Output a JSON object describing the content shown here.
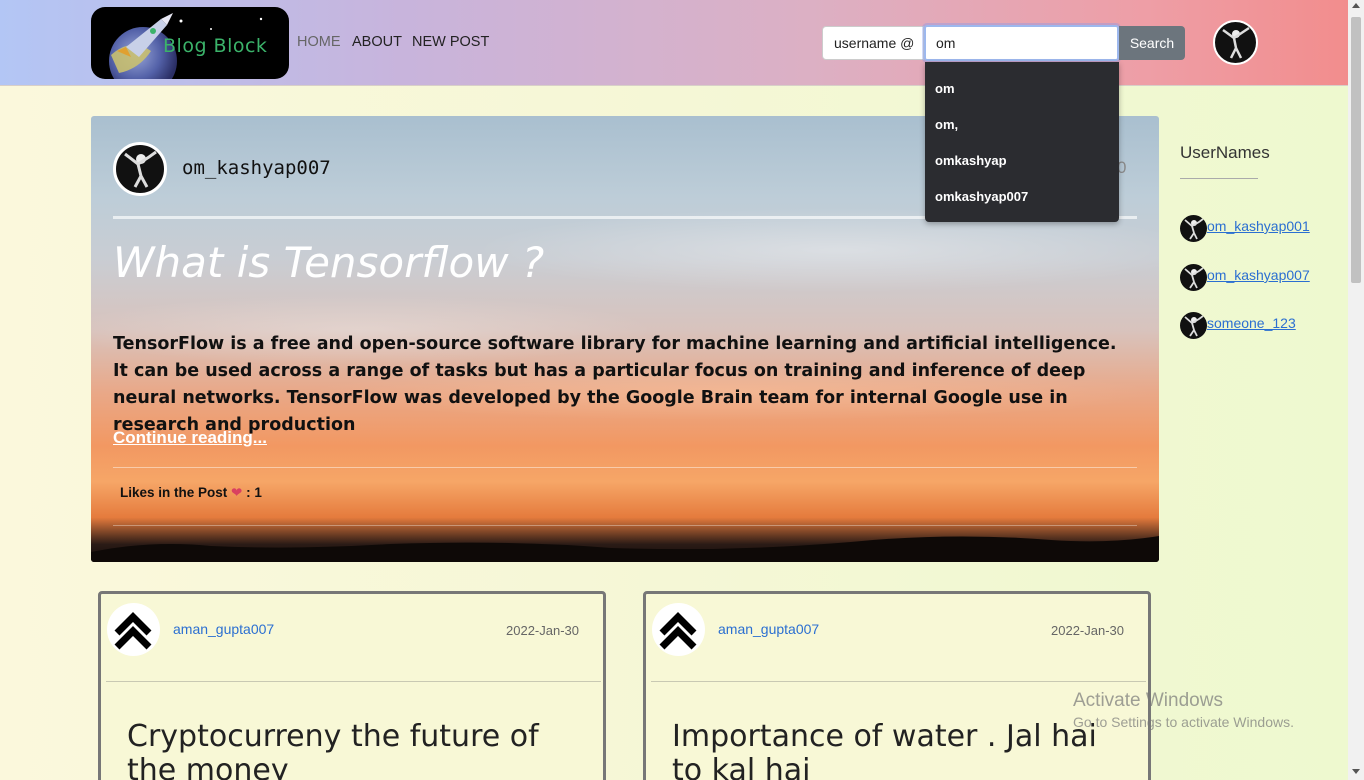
{
  "navbar": {
    "brand": "Blog Block",
    "links": [
      {
        "label": "HOME",
        "active": true
      },
      {
        "label": "ABOUT",
        "active": false
      },
      {
        "label": "NEW POST",
        "active": false
      }
    ],
    "search": {
      "prefix": "username @",
      "value": "om",
      "button_label": "Search",
      "suggestions": [
        "om",
        "om,",
        "omkashyap",
        "omkashyap007"
      ]
    }
  },
  "featured_post": {
    "author": "om_kashyap007",
    "count_text": "0",
    "title": "What is Tensorflow ?",
    "excerpt": "TensorFlow is a free and open-source software library for machine learning and artificial intelligence. It can be used across a range of tasks but has a particular focus on training and inference of deep neural networks. TensorFlow was developed by the Google Brain team for internal Google use in research and production",
    "read_more": "Continue reading...",
    "likes_label": "Likes in the Post",
    "likes_separator": ": 1",
    "heart_glyph": "❤",
    "likes_count": 1
  },
  "sidebar": {
    "title": "UserNames",
    "users": [
      "om_kashyap001",
      "om_kashyap007",
      "someone_123"
    ]
  },
  "cards": [
    {
      "author": "aman_gupta007",
      "date": "2022-Jan-30",
      "title": "Cryptocurreny the future of the money"
    },
    {
      "author": "aman_gupta007",
      "date": "2022-Jan-30",
      "title": "Importance of water . Jal hai to kal hai"
    }
  ],
  "watermark": {
    "line1": "Activate Windows",
    "line2": "Go to Settings to activate Windows."
  },
  "colors": {
    "link": "#2b6fd1",
    "search_button": "#6c757d",
    "dropdown": "#2b2c30"
  }
}
